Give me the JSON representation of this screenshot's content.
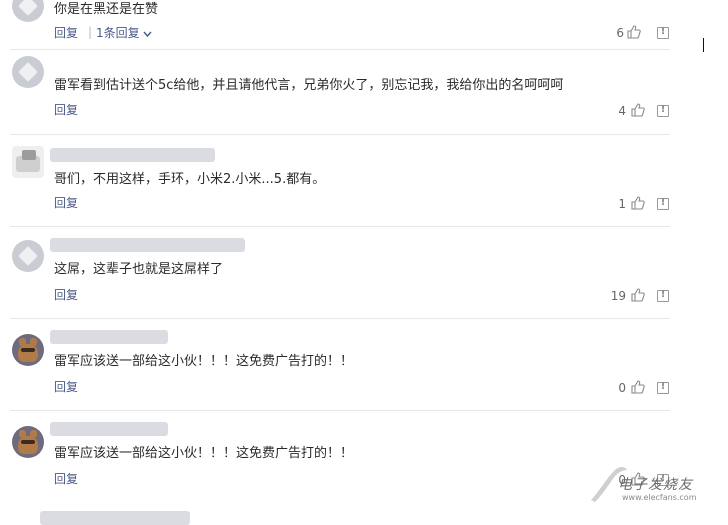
{
  "comments": [
    {
      "text": "你是在黑还是在赞",
      "reply_label": "回复",
      "replies_label": "1条回复",
      "likes": "6"
    },
    {
      "text": "雷军看到估计送个5c给他，并且请他代言，兄弟你火了，别忘记我，我给你出的名呵呵呵",
      "reply_label": "回复",
      "likes": "4"
    },
    {
      "text": "哥们，不用这样，手环，小米2.小米...5.都有。",
      "reply_label": "回复",
      "likes": "1"
    },
    {
      "text": "这屌，这辈子也就是这屌样了",
      "reply_label": "回复",
      "likes": "19"
    },
    {
      "text": "雷军应该送一部给这小伙！！！这免费广告打的！！",
      "reply_label": "回复",
      "likes": "0"
    },
    {
      "text": "雷军应该送一部给这小伙！！！这免费广告打的！！",
      "reply_label": "回复",
      "likes": "0"
    }
  ],
  "watermark": {
    "title": "电子发烧友",
    "url": "www.elecfans.com"
  },
  "icons": {
    "like": "thumbs-up-icon",
    "report": "report-icon",
    "chevron": "chevron-down-icon"
  }
}
